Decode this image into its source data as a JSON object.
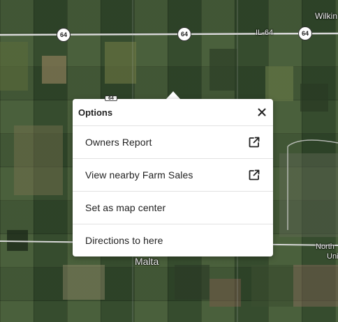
{
  "map": {
    "route_shields": [
      "64",
      "64",
      "64"
    ],
    "route_label": "IL-64",
    "place_labels": {
      "wilkin": "Wilkin",
      "malta": "Malta",
      "north": "North",
      "uni": "Uni"
    },
    "hidden_shield_label": "64"
  },
  "popup": {
    "title": "Options",
    "close_icon": "close-icon",
    "items": [
      {
        "label": "Owners Report",
        "icon": "external-link-icon"
      },
      {
        "label": "View nearby Farm Sales",
        "icon": "external-link-icon"
      },
      {
        "label": "Set as map center"
      },
      {
        "label": "Directions to here"
      }
    ]
  },
  "colors": {
    "popup_bg": "#ffffff",
    "text": "#222222",
    "divider": "#e2e2e2",
    "road": "#d8d8d8"
  }
}
